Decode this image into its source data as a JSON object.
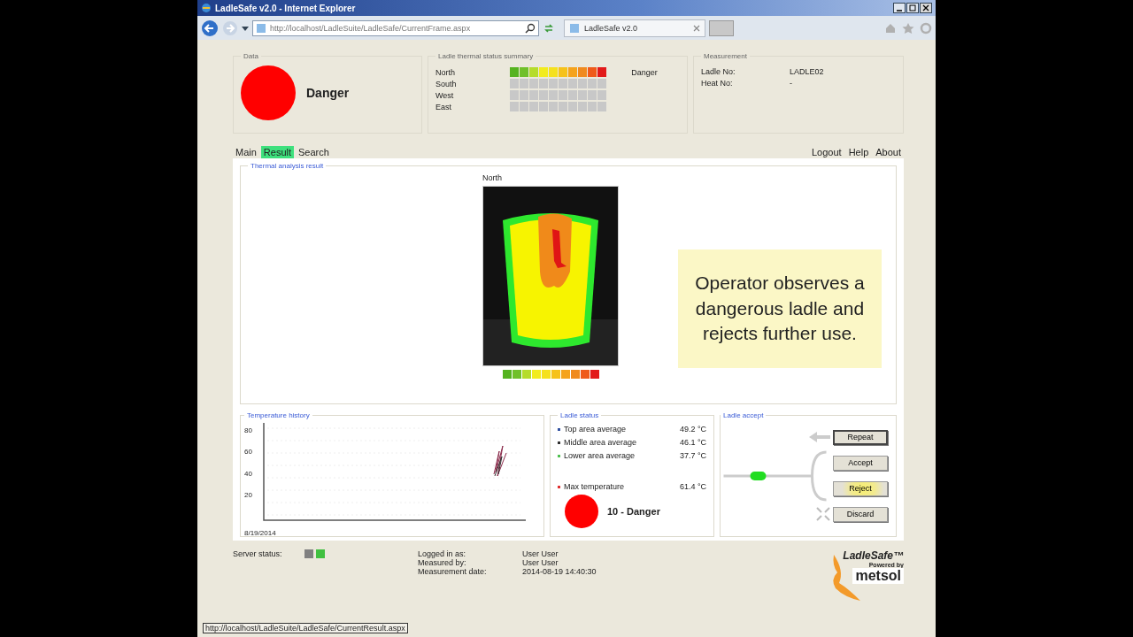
{
  "window": {
    "title": "LadleSafe v2.0 - Internet Explorer"
  },
  "browser": {
    "address": "http://localhost/LadleSuite/LadleSafe/CurrentFrame.aspx",
    "tabs": [
      {
        "label": "LadleSafe v2.0",
        "selected": true
      }
    ]
  },
  "data_panel": {
    "legend": "Data",
    "status": "Danger",
    "color": "#ff0000"
  },
  "summary": {
    "legend": "Ladle thermal status summary",
    "rows": [
      {
        "side": "North",
        "status": "Danger",
        "cells": [
          {
            "color": "#55b320"
          },
          {
            "color": "#70c02a"
          },
          {
            "color": "#b5dc2a"
          },
          {
            "color": "#f2ec1e"
          },
          {
            "color": "#f5e11e"
          },
          {
            "color": "#f6c21a"
          },
          {
            "color": "#f5a31c"
          },
          {
            "color": "#f08a1e"
          },
          {
            "color": "#ef5a1a"
          },
          {
            "color": "#e21a1a"
          }
        ]
      },
      {
        "side": "South",
        "cells": [
          {
            "color": "#c8c8c8"
          },
          {
            "color": "#c8c8c8"
          },
          {
            "color": "#c8c8c8"
          },
          {
            "color": "#c8c8c8"
          },
          {
            "color": "#c8c8c8"
          },
          {
            "color": "#c8c8c8"
          },
          {
            "color": "#c8c8c8"
          },
          {
            "color": "#c8c8c8"
          },
          {
            "color": "#c8c8c8"
          },
          {
            "color": "#c8c8c8"
          }
        ]
      },
      {
        "side": "West",
        "cells": [
          {
            "color": "#c8c8c8"
          },
          {
            "color": "#c8c8c8"
          },
          {
            "color": "#c8c8c8"
          },
          {
            "color": "#c8c8c8"
          },
          {
            "color": "#c8c8c8"
          },
          {
            "color": "#c8c8c8"
          },
          {
            "color": "#c8c8c8"
          },
          {
            "color": "#c8c8c8"
          },
          {
            "color": "#c8c8c8"
          },
          {
            "color": "#c8c8c8"
          }
        ]
      },
      {
        "side": "East",
        "cells": [
          {
            "color": "#c8c8c8"
          },
          {
            "color": "#c8c8c8"
          },
          {
            "color": "#c8c8c8"
          },
          {
            "color": "#c8c8c8"
          },
          {
            "color": "#c8c8c8"
          },
          {
            "color": "#c8c8c8"
          },
          {
            "color": "#c8c8c8"
          },
          {
            "color": "#c8c8c8"
          },
          {
            "color": "#c8c8c8"
          },
          {
            "color": "#c8c8c8"
          }
        ]
      }
    ]
  },
  "measurement": {
    "legend": "Measurement",
    "fields": [
      {
        "label": "Ladle No:",
        "value": "LADLE02"
      },
      {
        "label": "Heat No:",
        "value": "-"
      }
    ]
  },
  "nav_tabs": [
    {
      "label": "Main",
      "selected": false
    },
    {
      "label": "Result",
      "selected": true
    },
    {
      "label": "Search",
      "selected": false
    }
  ],
  "links": [
    "Logout",
    "Help",
    "About"
  ],
  "thermal": {
    "legend": "Thermal analysis result",
    "view": "North",
    "scale": [
      {
        "color": "#55b320"
      },
      {
        "color": "#70c02a"
      },
      {
        "color": "#b5dc2a"
      },
      {
        "color": "#f2ec1e"
      },
      {
        "color": "#f5e11e"
      },
      {
        "color": "#f6c21a"
      },
      {
        "color": "#f5a31c"
      },
      {
        "color": "#f08a1e"
      },
      {
        "color": "#ef5a1a"
      },
      {
        "color": "#e21a1a"
      }
    ]
  },
  "callout": "Operator observes a dangerous ladle and rejects further use.",
  "history": {
    "legend": "Temperature history",
    "y_labels": [
      "80",
      "60",
      "40",
      "20"
    ],
    "x_label": "8/19/2014"
  },
  "ladle_status": {
    "legend": "Ladle status",
    "readings": [
      {
        "label": "Top area average",
        "value": "49.2 °C",
        "color": "#3050a0",
        "kind": "average"
      },
      {
        "label": "Middle area average",
        "value": "46.1 °C",
        "color": "#303030",
        "kind": "average"
      },
      {
        "label": "Lower area average",
        "value": "37.7 °C",
        "color": "#50c050",
        "kind": "average"
      },
      {
        "label": "Max temperature",
        "value": "61.4 °C",
        "color": "#e03030",
        "kind": "max"
      }
    ],
    "rating": {
      "label": "10 - Danger",
      "color": "#ff0000"
    }
  },
  "accept": {
    "legend": "Ladle accept",
    "buttons": [
      {
        "label": "Repeat",
        "kind": "repeat",
        "highlighted": false
      },
      {
        "label": "Accept",
        "kind": "accept",
        "highlighted": false
      },
      {
        "label": "Reject",
        "kind": "reject",
        "highlighted": true
      },
      {
        "label": "Discard",
        "kind": "discard",
        "highlighted": false
      }
    ]
  },
  "footer": {
    "server_status": {
      "label": "Server status:",
      "lights": [
        {
          "color": "#808080"
        },
        {
          "color": "#40c040"
        }
      ]
    },
    "info": [
      {
        "label": "Logged in as:",
        "value": "User User"
      },
      {
        "label": "Measured by:",
        "value": "User User"
      },
      {
        "label": "Measurement date:",
        "value": "2014-08-19 14:40:30"
      }
    ],
    "brand": "LadleSafe™",
    "powered": "Powered by",
    "company": "metsol"
  },
  "status_bar": "http://localhost/LadleSuite/LadleSafe/CurrentResult.aspx"
}
